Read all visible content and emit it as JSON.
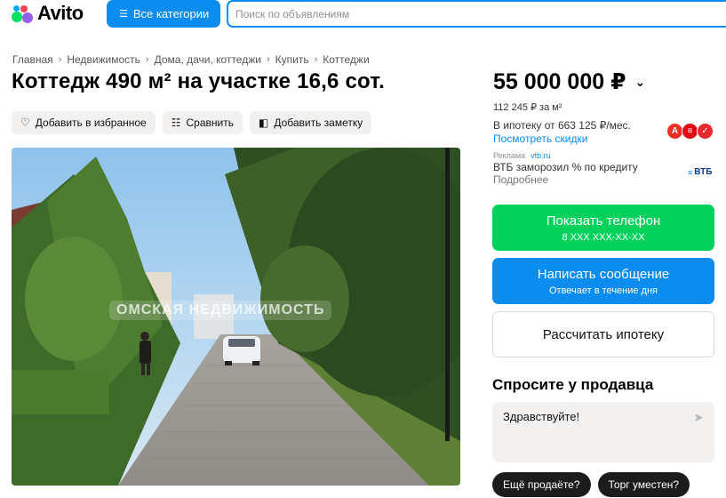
{
  "header": {
    "logo_text": "Avito",
    "categories_label": "Все категории",
    "search_placeholder": "Поиск по объявлениям"
  },
  "breadcrumbs": [
    "Главная",
    "Недвижимость",
    "Дома, дачи, коттеджи",
    "Купить",
    "Коттеджи"
  ],
  "listing": {
    "title": "Коттедж 490 м² на участке 16,6 сот.",
    "price": "55 000 000 ₽",
    "price_per_m2": "112 245 ₽ за м²",
    "mortgage_text": "В ипотеку от 663 125 ₽/мес.",
    "discount_link": "Посмотреть скидки"
  },
  "actions": {
    "favorite": "Добавить в избранное",
    "compare": "Сравнить",
    "note": "Добавить заметку"
  },
  "photo": {
    "watermark": "ОМСКАЯ НЕДВИЖИМОСТЬ"
  },
  "ad": {
    "label": "Реклама",
    "source": "vtb.ru",
    "text": "ВТБ заморозил % по кредиту",
    "more": "Подробнее",
    "brand": "ВТБ"
  },
  "banks": [
    {
      "letter": "А",
      "color": "#ef3124"
    },
    {
      "letter": "≡",
      "color": "#e30611"
    },
    {
      "letter": "✓",
      "color": "#e8262e"
    }
  ],
  "buttons": {
    "phone_label": "Показать телефон",
    "phone_masked": "8 XXX XXX-XX-XX",
    "message_label": "Написать сообщение",
    "message_sub": "Отвечает в течение дня",
    "mortgage_label": "Рассчитать ипотеку"
  },
  "seller": {
    "ask_title": "Спросите у продавца",
    "message_value": "Здравствуйте!",
    "chips": [
      "Ещё продаёте?",
      "Торг уместен?"
    ]
  },
  "colors": {
    "accent": "#0a8cf0",
    "green": "#02d15c"
  }
}
